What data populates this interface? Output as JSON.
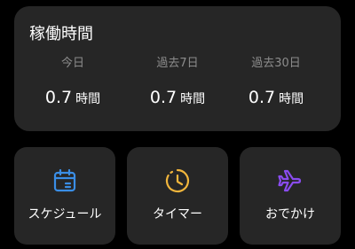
{
  "usage": {
    "title": "稼働時間",
    "stats": [
      {
        "label": "今日",
        "value": "0.7",
        "unit": "時間"
      },
      {
        "label": "過去7日",
        "value": "0.7",
        "unit": "時間"
      },
      {
        "label": "過去30日",
        "value": "0.7",
        "unit": "時間"
      }
    ]
  },
  "actions": [
    {
      "label": "スケジュール",
      "icon": "calendar-icon",
      "color": "#3a8ee6"
    },
    {
      "label": "タイマー",
      "icon": "timer-icon",
      "color": "#f2b63c"
    },
    {
      "label": "おでかけ",
      "icon": "airplane-icon",
      "color": "#8a4cf0"
    }
  ],
  "colors": {
    "background": "#000000",
    "card": "#262626",
    "secondary_text": "#8c8c8c"
  }
}
